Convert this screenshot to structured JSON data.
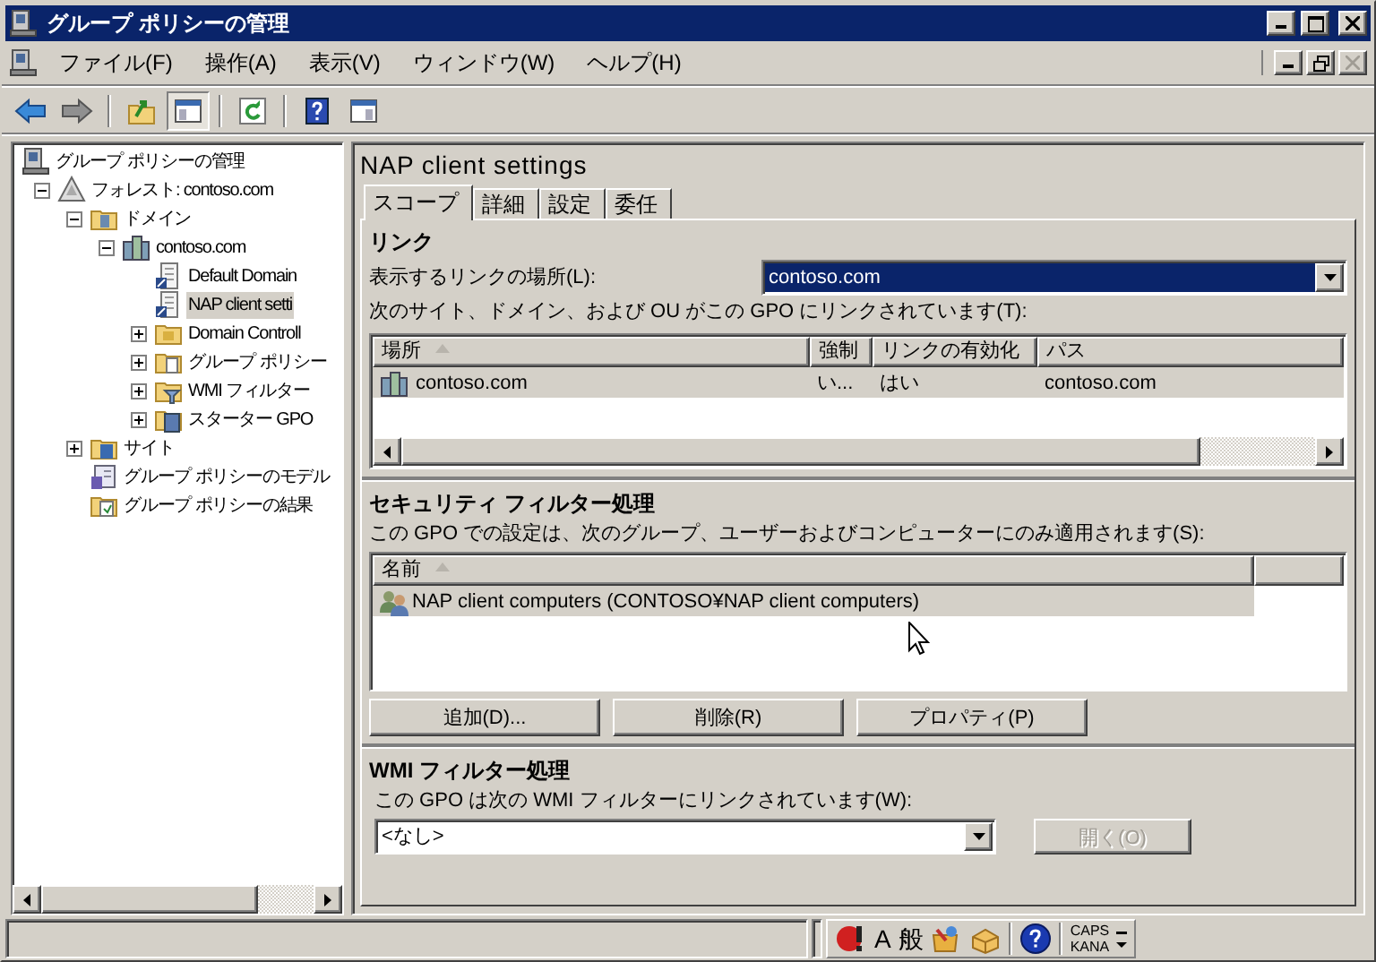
{
  "window": {
    "title": "グループ ポリシーの管理"
  },
  "menu": [
    {
      "label": "ファイル(F)"
    },
    {
      "label": "操作(A)"
    },
    {
      "label": "表示(V)"
    },
    {
      "label": "ウィンドウ(W)"
    },
    {
      "label": "ヘルプ(H)"
    }
  ],
  "toolbar": [
    {
      "pressed": false
    },
    {
      "pressed": false
    },
    {
      "pressed": false
    },
    {
      "pressed": true
    },
    {
      "pressed": false
    },
    {
      "pressed": false
    },
    {
      "pressed": false
    }
  ],
  "tree": [
    {
      "label": "グループ ポリシーの管理",
      "kind": "console",
      "selected": false,
      "children": [
        {
          "label": "フォレスト: contoso.com",
          "kind": "forest",
          "selected": false,
          "expanded": true,
          "children": [
            {
              "label": "ドメイン",
              "kind": "domains",
              "selected": false,
              "expanded": true,
              "children": [
                {
                  "label": "contoso.com",
                  "kind": "domain",
                  "selected": false,
                  "expanded": true,
                  "children": [
                    {
                      "label": "Default Domain",
                      "kind": "gpo",
                      "selected": false
                    },
                    {
                      "label": "NAP client setti",
                      "kind": "gpo",
                      "selected": true
                    },
                    {
                      "label": "Domain Controll",
                      "kind": "ou",
                      "selected": false,
                      "expanded": false
                    },
                    {
                      "label": "グループ ポリシー",
                      "kind": "gpofolder",
                      "selected": false,
                      "expanded": false
                    },
                    {
                      "label": "WMI フィルター",
                      "kind": "wmi",
                      "selected": false,
                      "expanded": false
                    },
                    {
                      "label": "スターター GPO",
                      "kind": "starter",
                      "selected": false,
                      "expanded": false
                    }
                  ]
                }
              ]
            },
            {
              "label": "サイト",
              "kind": "sites",
              "selected": false,
              "expanded": false
            },
            {
              "label": "グループ ポリシーのモデル",
              "kind": "modeling",
              "selected": false
            },
            {
              "label": "グループ ポリシーの結果",
              "kind": "results",
              "selected": false
            }
          ]
        }
      ]
    }
  ],
  "details": {
    "title": "NAP client settings",
    "tabs": [
      {
        "label": "スコープ",
        "selected": true
      },
      {
        "label": "詳細",
        "selected": false
      },
      {
        "label": "設定",
        "selected": false
      },
      {
        "label": "委任",
        "selected": false
      }
    ],
    "links": {
      "heading": "リンク",
      "location_label": "表示するリンクの場所(L):",
      "location": {
        "value": "contoso.com",
        "focused": true
      },
      "description": "次のサイト、ドメイン、および OU がこの GPO にリンクされています(T):",
      "columns": [
        {
          "label": "場所",
          "sorted": true
        },
        {
          "label": "強制",
          "sorted": false
        },
        {
          "label": "リンクの有効化",
          "sorted": false
        },
        {
          "label": "パス",
          "sorted": false
        }
      ],
      "rows": [
        {
          "selected": true,
          "cells": [
            "contoso.com",
            "い...",
            "はい",
            "contoso.com"
          ]
        }
      ]
    },
    "security": {
      "heading": "セキュリティ フィルター処理",
      "description": "この GPO での設定は、次のグループ、ユーザーおよびコンピューターにのみ適用されます(S):",
      "columns": [
        {
          "label": "名前",
          "sorted": true
        }
      ],
      "rows": [
        {
          "label": "NAP client computers (CONTOSO¥NAP client computers)",
          "selected": true
        }
      ],
      "buttons": [
        {
          "label": "追加(D)...",
          "disabled": false
        },
        {
          "label": "削除(R)",
          "disabled": false
        },
        {
          "label": "プロパティ(P)",
          "disabled": false
        }
      ]
    },
    "wmi": {
      "heading": "WMI フィルター処理",
      "description": "この GPO は次の WMI フィルターにリンクされています(W):",
      "filter": {
        "value": "<なし>"
      },
      "button": {
        "label": "開く(O)",
        "disabled": true
      }
    }
  },
  "status_bar": {
    "ime": {
      "mode": "A",
      "conversion": "般",
      "caps": "CAPS",
      "kana": "KANA"
    }
  }
}
